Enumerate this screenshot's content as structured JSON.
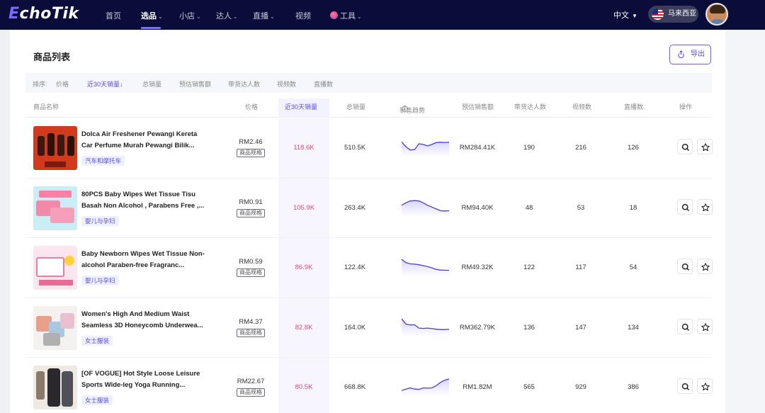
{
  "brand": {
    "logo_prefix": "E",
    "logo_rest": "choTik"
  },
  "nav": {
    "items": [
      {
        "label": "首页",
        "caret": false,
        "active": false
      },
      {
        "label": "选品",
        "caret": true,
        "active": true
      },
      {
        "label": "小店",
        "caret": true,
        "active": false
      },
      {
        "label": "达人",
        "caret": true,
        "active": false
      },
      {
        "label": "直播",
        "caret": true,
        "active": false
      },
      {
        "label": "视频",
        "caret": false,
        "active": false
      },
      {
        "label": "工具",
        "caret": true,
        "active": false
      }
    ],
    "language": "中文",
    "country": "马来西亚"
  },
  "page": {
    "title": "商品列表",
    "export_label": "导出"
  },
  "sort": {
    "prefix": "排序:",
    "options": [
      "价格",
      "近30天销量↓",
      "总销量",
      "预估销售额",
      "带货达人数",
      "视频数",
      "直播数"
    ],
    "active_index": 1
  },
  "columns": {
    "name": "商品名称",
    "price": "价格",
    "sales30": "近30天销量",
    "total": "总销量",
    "trend": "销售趋势",
    "revenue": "预估销售额",
    "creators": "带货达人数",
    "videos": "视频数",
    "lives": "直播数",
    "actions": "操作"
  },
  "spec_label": "商品规格",
  "colors": {
    "accent": "#5a4bd6",
    "sales_highlight": "#e0467a",
    "nav_bg": "#0a0c3a"
  },
  "products": [
    {
      "name": "Dolca Air Freshener Pewangi Kereta Car Perfume Murah Pewangi Bilik...",
      "category": "汽车和摩托车",
      "price": "RM2.46",
      "sales30": "118.6K",
      "total": "510.5K",
      "revenue": "RM284.41K",
      "creators": "190",
      "videos": "216",
      "lives": "126",
      "trend": [
        0.72,
        0.45,
        0.28,
        0.3,
        0.62,
        0.58,
        0.5,
        0.58,
        0.68,
        0.7,
        0.69,
        0.7
      ]
    },
    {
      "name": "80PCS Baby Wipes Wet Tissue Tisu Basah Non Alcohol , Parabens Free ,...",
      "category": "婴儿与孕妇",
      "price": "RM0.91",
      "sales30": "105.9K",
      "total": "263.4K",
      "revenue": "RM94.40K",
      "creators": "48",
      "videos": "53",
      "lives": "18",
      "trend": [
        0.55,
        0.68,
        0.78,
        0.8,
        0.78,
        0.68,
        0.55,
        0.45,
        0.35,
        0.25,
        0.24,
        0.25
      ]
    },
    {
      "name": "Baby Newborn Wipes Wet Tissue Non-alcohol Paraben-free Fragranc...",
      "category": "婴儿与孕妇",
      "price": "RM0.59",
      "sales30": "86.9K",
      "total": "122.4K",
      "revenue": "RM49.32K",
      "creators": "122",
      "videos": "117",
      "lives": "54",
      "trend": [
        0.85,
        0.66,
        0.6,
        0.58,
        0.55,
        0.5,
        0.45,
        0.38,
        0.3,
        0.26,
        0.25,
        0.25
      ]
    },
    {
      "name": "Women's High And Medium Waist Seamless 3D Honeycomb Underwea...",
      "category": "女士服装",
      "price": "RM4.37",
      "sales30": "82.8K",
      "total": "164.0K",
      "revenue": "RM362.79K",
      "creators": "136",
      "videos": "147",
      "lives": "134",
      "trend": [
        0.88,
        0.6,
        0.55,
        0.56,
        0.38,
        0.36,
        0.38,
        0.35,
        0.32,
        0.3,
        0.3,
        0.31
      ]
    },
    {
      "name": "[OF VOGUE] Hot Style Loose Leisure Sports Wide-leg Yoga Running...",
      "category": "女士服装",
      "price": "RM22.67",
      "sales30": "80.5K",
      "total": "668.8K",
      "revenue": "RM1.82M",
      "creators": "565",
      "videos": "929",
      "lives": "386",
      "trend": [
        0.22,
        0.3,
        0.36,
        0.3,
        0.28,
        0.36,
        0.35,
        0.36,
        0.48,
        0.66,
        0.78,
        0.85
      ]
    }
  ]
}
